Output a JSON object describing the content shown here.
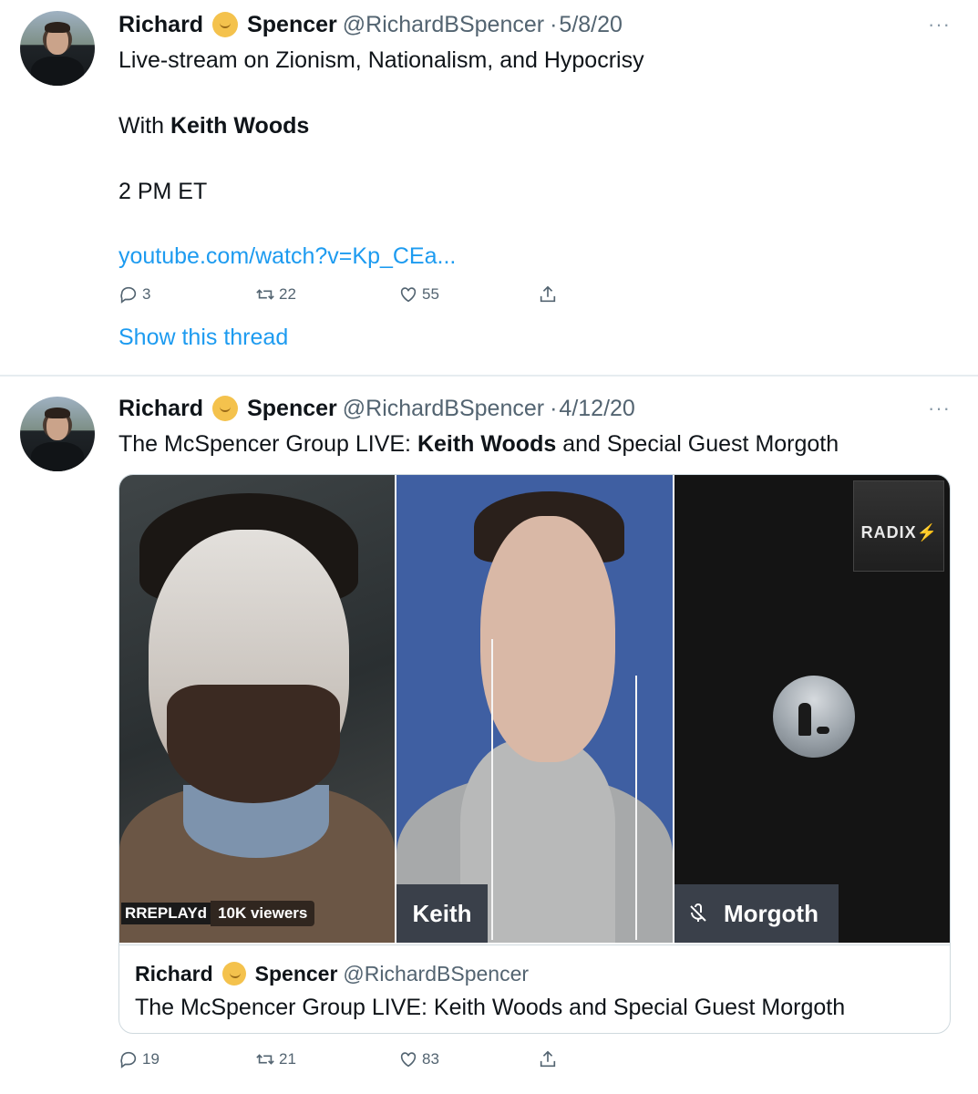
{
  "tweet1": {
    "first_name": "Richard",
    "last_name": "Spencer",
    "handle": "@RichardBSpencer",
    "date": "5/8/20",
    "more": "···",
    "line1": "Live-stream on Zionism, Nationalism, and Hypocrisy",
    "with_prefix": "With ",
    "with_name": "Keith Woods",
    "time": "2 PM ET",
    "link": "youtube.com/watch?v=Kp_CEa...",
    "replies": "3",
    "retweets": "22",
    "likes": "55",
    "show_thread": "Show this thread"
  },
  "tweet2": {
    "first_name": "Richard",
    "last_name": "Spencer",
    "handle": "@RichardBSpencer",
    "date": "4/12/20",
    "more": "···",
    "text_prefix": "The McSpencer Group LIVE: ",
    "text_bold": "Keith Woods",
    "text_suffix": " and Special Guest Morgoth",
    "media": {
      "panel1_label": "RREPLAYd",
      "replay_badge": "REPLAY",
      "viewers": "10K viewers",
      "panel2_label": "Keith",
      "panel3_label": "Morgoth",
      "radix_logo": "RADIX⚡"
    },
    "quote": {
      "first_name": "Richard",
      "last_name": "Spencer",
      "handle": "@RichardBSpencer",
      "text": "The McSpencer Group LIVE: Keith Woods and Special Guest Morgoth"
    },
    "replies": "19",
    "retweets": "21",
    "likes": "83"
  },
  "colors": {
    "link": "#1d9bf0",
    "secondary_text": "#536471",
    "divider": "#e6ecf0"
  }
}
